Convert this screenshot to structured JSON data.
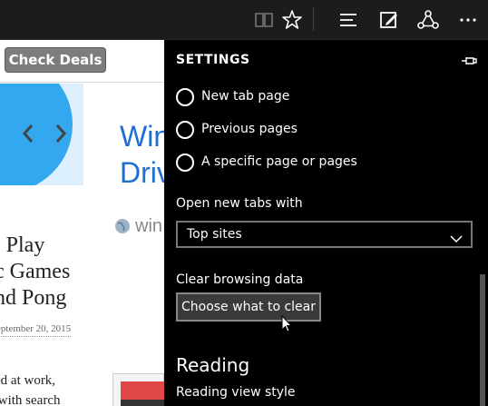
{
  "toolbar": {
    "icons": [
      "reading-view-icon",
      "favorite-star-icon",
      "hub-icon",
      "web-note-icon",
      "share-icon",
      "more-icon"
    ]
  },
  "webpage": {
    "deals_button": "Check Deals",
    "article_title": "Win\nDriv",
    "site_text": "win",
    "headline": ": Play\nc Games\nnd Pong",
    "date": "eptember 20, 2015",
    "body_text": "ed at work,\n with search"
  },
  "settings": {
    "title": "SETTINGS",
    "startup_options": [
      "New tab page",
      "Previous pages",
      "A specific page or pages"
    ],
    "open_tabs_label": "Open new tabs with",
    "open_tabs_value": "Top sites",
    "clear_label": "Clear browsing data",
    "clear_button": "Choose what to clear",
    "reading_heading": "Reading",
    "reading_view_style": "Reading view style"
  }
}
